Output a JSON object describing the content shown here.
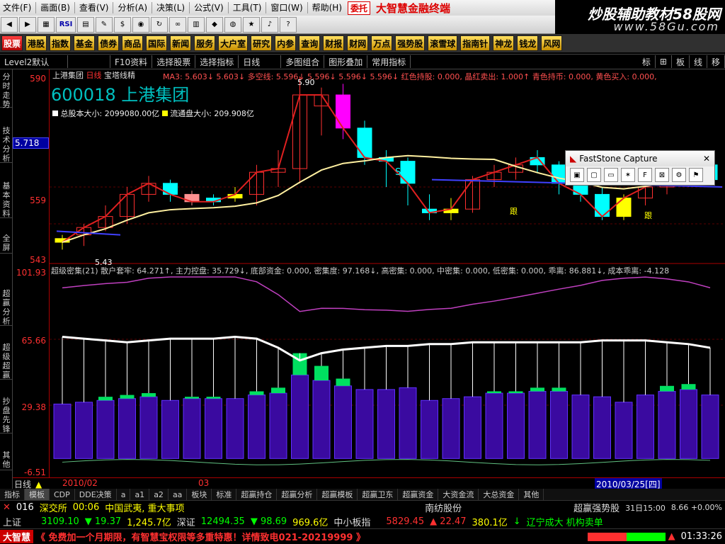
{
  "menu": {
    "items": [
      "文件(F)",
      "画面(B)",
      "查看(V)",
      "分析(A)",
      "决策(L)",
      "公式(V)",
      "工具(T)",
      "窗口(W)",
      "帮助(H)"
    ],
    "tag": "委托",
    "brand": "大智慧金融终端"
  },
  "promo": {
    "line1": "炒股辅助教材58股网",
    "line2": "www.58Gu.com"
  },
  "toolbar1": {
    "rsi": "RSI"
  },
  "toolbar2": {
    "items": [
      "股票",
      "港股",
      "指数",
      "基金",
      "债券",
      "商品",
      "国际",
      "新闻",
      "服务",
      "大户室",
      "研究",
      "内参",
      "查询",
      "财报",
      "财网",
      "万点",
      "强势股",
      "滚雪球",
      "指南针",
      "神龙",
      "钱龙",
      "风网"
    ]
  },
  "toolbar3": {
    "items": [
      "Level2默认",
      "",
      "F10资料",
      "选择股票",
      "选择指标",
      "日线",
      "多图组合",
      "图形叠加",
      "常用指标"
    ],
    "right": [
      "标",
      "板",
      "线",
      "移"
    ]
  },
  "lefttabs": [
    "分时走势",
    "技术分析",
    "基本资料",
    "全屏",
    "超赢分析",
    "超级超赢",
    "抄盘先锋",
    "其他"
  ],
  "stock": {
    "code": "600018",
    "name": "上港集团",
    "daily": "日线",
    "indicator": "宝塔线精"
  },
  "top_info": {
    "line": "MA3: 5.603↓  5.603↓  多空线: 5.596↓  5.596↓  5.596↓  5.596↓  红色持股: 0.000,  晶红卖出: 1.000↑  青色持币: 0.000,  黄色买入: 0.000,",
    "capital": "总股本大小: 2099080.00亿",
    "float": "流通盘大小: 209.908亿",
    "hi": "5.90",
    "lo": "5.43",
    "markS": "S",
    "gen1": "跟",
    "gen2": "跟"
  },
  "axis_top": {
    "t1": "590",
    "t2": "5.718",
    "t3": "559",
    "t4": "543"
  },
  "axis_bot": {
    "b1": "101.93",
    "b2": "65.66",
    "b3": "29.38",
    "b4": "-6.51"
  },
  "lower_info": "超级密集(21)  散户套牢: 64.271↑,  主力控盘: 35.729↓,  底部资金: 0.000,  密集度: 97.168↓,  高密集: 0.000,  中密集: 0.000,  低密集: 0.000,  乖离: 86.881↓,  成本乖离: -4.128",
  "fastcapture": {
    "title": "FastStone Capture",
    "close": "✕"
  },
  "dates": {
    "label": "日线",
    "d1": "2010/02",
    "d2": "03",
    "d3": "2010/03/25[四]"
  },
  "bottomtabs": [
    "指标",
    "模板",
    "CDP",
    "DDE决策",
    "a",
    "a1",
    "a2",
    "aa",
    "板块",
    "标准",
    "超赢持仓",
    "超赢分析",
    "超赢模板",
    "超赢卫东",
    "超赢资金",
    "大资金流",
    "大总资金",
    "其他"
  ],
  "ticker1": {
    "num": "016",
    "exch": "深交所",
    "time": "00:06",
    "news": "中国武夷, 重大事项",
    "stock2": "南纺股份",
    "sect": "超赢强势股",
    "time2": "31日15:00",
    "val2": "8.66 +0.00%"
  },
  "ticker2": {
    "idx1": "上证",
    "v1": "3109.10",
    "c1": "▼ 19.37",
    "a1": "1,245.7亿",
    "idx2": "深证",
    "v2": "12494.35",
    "c2": "▼ 98.69",
    "a2": "969.6亿",
    "idx3": "中小板指",
    "v3": "5829.45",
    "c3": "▲ 22.47",
    "a3": "380.1亿",
    "news2": "辽宁成大 机构卖单"
  },
  "ticker3": {
    "logo": "大智慧",
    "msg": "《 免费加一个月期限，有智慧宝权限等多重特惠！详情致电021-20219999 》",
    "clock": "01:33:26"
  },
  "colors": {
    "up": "#ff3030",
    "down": "#00ffff",
    "text_red": "#ff3030",
    "accent": "#3030ff"
  },
  "chart_data": {
    "type": "candlestick",
    "candles": [
      {
        "o": 5.46,
        "c": 5.45,
        "h": 5.47,
        "l": 5.43,
        "col": "yellow"
      },
      {
        "o": 5.47,
        "c": 5.49,
        "h": 5.5,
        "l": 5.44,
        "col": "red"
      },
      {
        "o": 5.49,
        "c": 5.52,
        "h": 5.55,
        "l": 5.48,
        "col": "red"
      },
      {
        "o": 5.52,
        "c": 5.58,
        "h": 5.6,
        "l": 5.5,
        "col": "red"
      },
      {
        "o": 5.58,
        "c": 5.61,
        "h": 5.63,
        "l": 5.56,
        "col": "red"
      },
      {
        "o": 5.61,
        "c": 5.58,
        "h": 5.62,
        "l": 5.56,
        "col": "cyan"
      },
      {
        "o": 5.58,
        "c": 5.56,
        "h": 5.59,
        "l": 5.55,
        "col": "pink"
      },
      {
        "o": 5.57,
        "c": 5.56,
        "h": 5.58,
        "l": 5.55,
        "col": "cyan"
      },
      {
        "o": 5.57,
        "c": 5.58,
        "h": 5.6,
        "l": 5.56,
        "col": "yellow"
      },
      {
        "o": 5.58,
        "c": 5.64,
        "h": 5.66,
        "l": 5.55,
        "col": "red"
      },
      {
        "o": 5.64,
        "c": 5.65,
        "h": 5.7,
        "l": 5.6,
        "col": "red"
      },
      {
        "o": 5.65,
        "c": 5.85,
        "h": 5.9,
        "l": 5.61,
        "col": "red"
      },
      {
        "o": 5.82,
        "c": 5.85,
        "h": 5.87,
        "l": 5.74,
        "col": "red"
      },
      {
        "o": 5.85,
        "c": 5.76,
        "h": 5.88,
        "l": 5.73,
        "col": "magenta"
      },
      {
        "o": 5.76,
        "c": 5.68,
        "h": 5.78,
        "l": 5.66,
        "col": "cyan"
      },
      {
        "o": 5.68,
        "c": 5.67,
        "h": 5.7,
        "l": 5.6,
        "col": "cyan"
      },
      {
        "o": 5.67,
        "c": 5.61,
        "h": 5.68,
        "l": 5.55,
        "col": "cyan"
      },
      {
        "o": 5.54,
        "c": 5.53,
        "h": 5.58,
        "l": 5.51,
        "col": "cyan"
      },
      {
        "o": 5.53,
        "c": 5.54,
        "h": 5.57,
        "l": 5.51,
        "col": "yellow"
      },
      {
        "o": 5.54,
        "c": 5.62,
        "h": 5.63,
        "l": 5.53,
        "col": "red"
      },
      {
        "o": 5.62,
        "c": 5.64,
        "h": 5.66,
        "l": 5.6,
        "col": "red"
      },
      {
        "o": 5.64,
        "c": 5.66,
        "h": 5.68,
        "l": 5.62,
        "col": "red"
      },
      {
        "o": 5.66,
        "c": 5.68,
        "h": 5.7,
        "l": 5.64,
        "col": "cyan"
      },
      {
        "o": 5.66,
        "c": 5.61,
        "h": 5.67,
        "l": 5.58,
        "col": "cyan"
      },
      {
        "o": 5.61,
        "c": 5.58,
        "h": 5.63,
        "l": 5.56,
        "col": "cyan"
      },
      {
        "o": 5.58,
        "c": 5.52,
        "h": 5.6,
        "l": 5.51,
        "col": "cyan"
      },
      {
        "o": 5.52,
        "c": 5.57,
        "h": 5.58,
        "l": 5.51,
        "col": "yellow"
      },
      {
        "o": 5.57,
        "c": 5.6,
        "h": 5.62,
        "l": 5.55,
        "col": "red"
      },
      {
        "o": 5.6,
        "c": 5.63,
        "h": 5.65,
        "l": 5.58,
        "col": "red"
      },
      {
        "o": 5.63,
        "c": 5.62,
        "h": 5.66,
        "l": 5.6,
        "col": "red"
      },
      {
        "o": 5.62,
        "c": 5.66,
        "h": 5.67,
        "l": 5.61,
        "col": "cyan"
      }
    ],
    "bars": [
      30,
      31,
      32,
      33,
      34,
      32,
      33,
      33,
      33,
      35,
      36,
      46,
      43,
      40,
      38,
      38,
      39,
      32,
      33,
      34,
      36,
      36,
      37,
      37,
      35,
      34,
      31,
      35,
      37,
      38,
      35
    ],
    "green": [
      0,
      0,
      2,
      2,
      2,
      0,
      1,
      1,
      0,
      2,
      3,
      12,
      8,
      4,
      0,
      0,
      0,
      0,
      0,
      0,
      1,
      1,
      2,
      2,
      0,
      0,
      0,
      0,
      3,
      3,
      0
    ],
    "white": [
      67,
      66,
      65,
      64,
      65,
      66,
      66,
      66,
      67,
      66,
      61,
      54,
      58,
      60,
      61,
      62,
      62,
      63,
      63,
      64,
      64,
      64,
      64,
      64,
      64,
      65,
      65,
      65,
      64,
      63,
      61
    ]
  }
}
